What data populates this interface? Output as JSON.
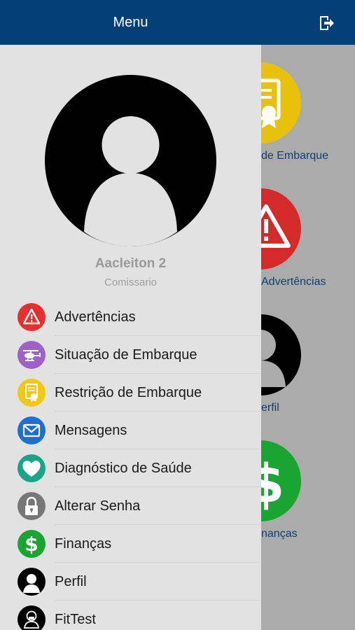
{
  "drawer": {
    "title": "Menu",
    "user": {
      "name": "Aacleiton 2",
      "role": "Comissario"
    },
    "items": [
      {
        "label": "Advertências",
        "icon": "warning-icon",
        "color": "#e53030"
      },
      {
        "label": "Situação de Embarque",
        "icon": "helicopter-icon",
        "color": "#a060c9"
      },
      {
        "label": "Restrição de Embarque",
        "icon": "certificate-icon",
        "color": "#f2c811"
      },
      {
        "label": "Mensagens",
        "icon": "envelope-icon",
        "color": "#1f6fd1"
      },
      {
        "label": "Diagnóstico de Saúde",
        "icon": "heart-icon",
        "color": "#18a58a"
      },
      {
        "label": "Alterar Senha",
        "icon": "lock-icon",
        "color": "#777777"
      },
      {
        "label": "Finanças",
        "icon": "dollar-icon",
        "color": "#1aa532"
      },
      {
        "label": "Perfil",
        "icon": "person-icon",
        "color": "#000000"
      },
      {
        "label": "FitTest",
        "icon": "mask-person-icon",
        "color": "#000000"
      }
    ]
  },
  "background": {
    "tiles": [
      {
        "label": "Restrição de Embarque",
        "visible_label": "de Embarque",
        "icon": "certificate-icon",
        "color": "#e7c10c"
      },
      {
        "label": "Advertências",
        "visible_label": "Advertências",
        "icon": "warning-icon",
        "color": "#d42a2a"
      },
      {
        "label": "Perfil",
        "visible_label": "erfil",
        "icon": "person-icon",
        "color": "#000000"
      },
      {
        "label": "Finanças",
        "visible_label": "nanças",
        "icon": "dollar-icon",
        "color": "#1aa532"
      }
    ]
  },
  "colors": {
    "header": "#053f77",
    "drawer_bg": "#e2e2e2",
    "overlay": "#ababab"
  }
}
